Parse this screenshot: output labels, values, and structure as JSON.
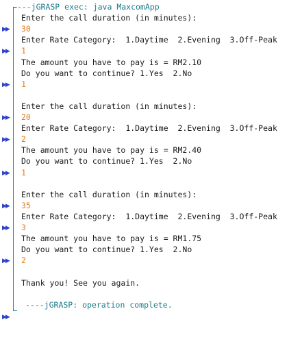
{
  "console": {
    "header": "----jGRASP exec: java MaxcomApp",
    "footer": "----jGRASP: operation complete.",
    "lines": [
      {
        "type": "out",
        "text": "Enter the call duration (in minutes):",
        "arrow": false
      },
      {
        "type": "in",
        "text": "30",
        "arrow": true
      },
      {
        "type": "out",
        "text": "Enter Rate Category:  1.Daytime  2.Evening  3.Off-Peak",
        "arrow": false
      },
      {
        "type": "in",
        "text": "1",
        "arrow": true
      },
      {
        "type": "out",
        "text": "The amount you have to pay is = RM2.10",
        "arrow": false
      },
      {
        "type": "out",
        "text": "Do you want to continue? 1.Yes  2.No",
        "arrow": false
      },
      {
        "type": "in",
        "text": "1",
        "arrow": true
      },
      {
        "type": "blank",
        "text": "",
        "arrow": false
      },
      {
        "type": "out",
        "text": "Enter the call duration (in minutes):",
        "arrow": false
      },
      {
        "type": "in",
        "text": "20",
        "arrow": true
      },
      {
        "type": "out",
        "text": "Enter Rate Category:  1.Daytime  2.Evening  3.Off-Peak",
        "arrow": false
      },
      {
        "type": "in",
        "text": "2",
        "arrow": true
      },
      {
        "type": "out",
        "text": "The amount you have to pay is = RM2.40",
        "arrow": false
      },
      {
        "type": "out",
        "text": "Do you want to continue? 1.Yes  2.No",
        "arrow": false
      },
      {
        "type": "in",
        "text": "1",
        "arrow": true
      },
      {
        "type": "blank",
        "text": "",
        "arrow": false
      },
      {
        "type": "out",
        "text": "Enter the call duration (in minutes):",
        "arrow": false
      },
      {
        "type": "in",
        "text": "35",
        "arrow": true
      },
      {
        "type": "out",
        "text": "Enter Rate Category:  1.Daytime  2.Evening  3.Off-Peak",
        "arrow": false
      },
      {
        "type": "in",
        "text": "3",
        "arrow": true
      },
      {
        "type": "out",
        "text": "The amount you have to pay is = RM1.75",
        "arrow": false
      },
      {
        "type": "out",
        "text": "Do you want to continue? 1.Yes  2.No",
        "arrow": false
      },
      {
        "type": "in",
        "text": "2",
        "arrow": true
      },
      {
        "type": "blank",
        "text": "",
        "arrow": false
      },
      {
        "type": "out",
        "text": "Thank you! See you again.",
        "arrow": false
      },
      {
        "type": "blank",
        "text": "",
        "arrow": false
      }
    ],
    "input_arrow_icon": "input-arrow-icon",
    "colors": {
      "output": "#1a1a1a",
      "input": "#e07b1a",
      "system": "#1a7a8a",
      "arrow": "#2e43c8"
    }
  }
}
